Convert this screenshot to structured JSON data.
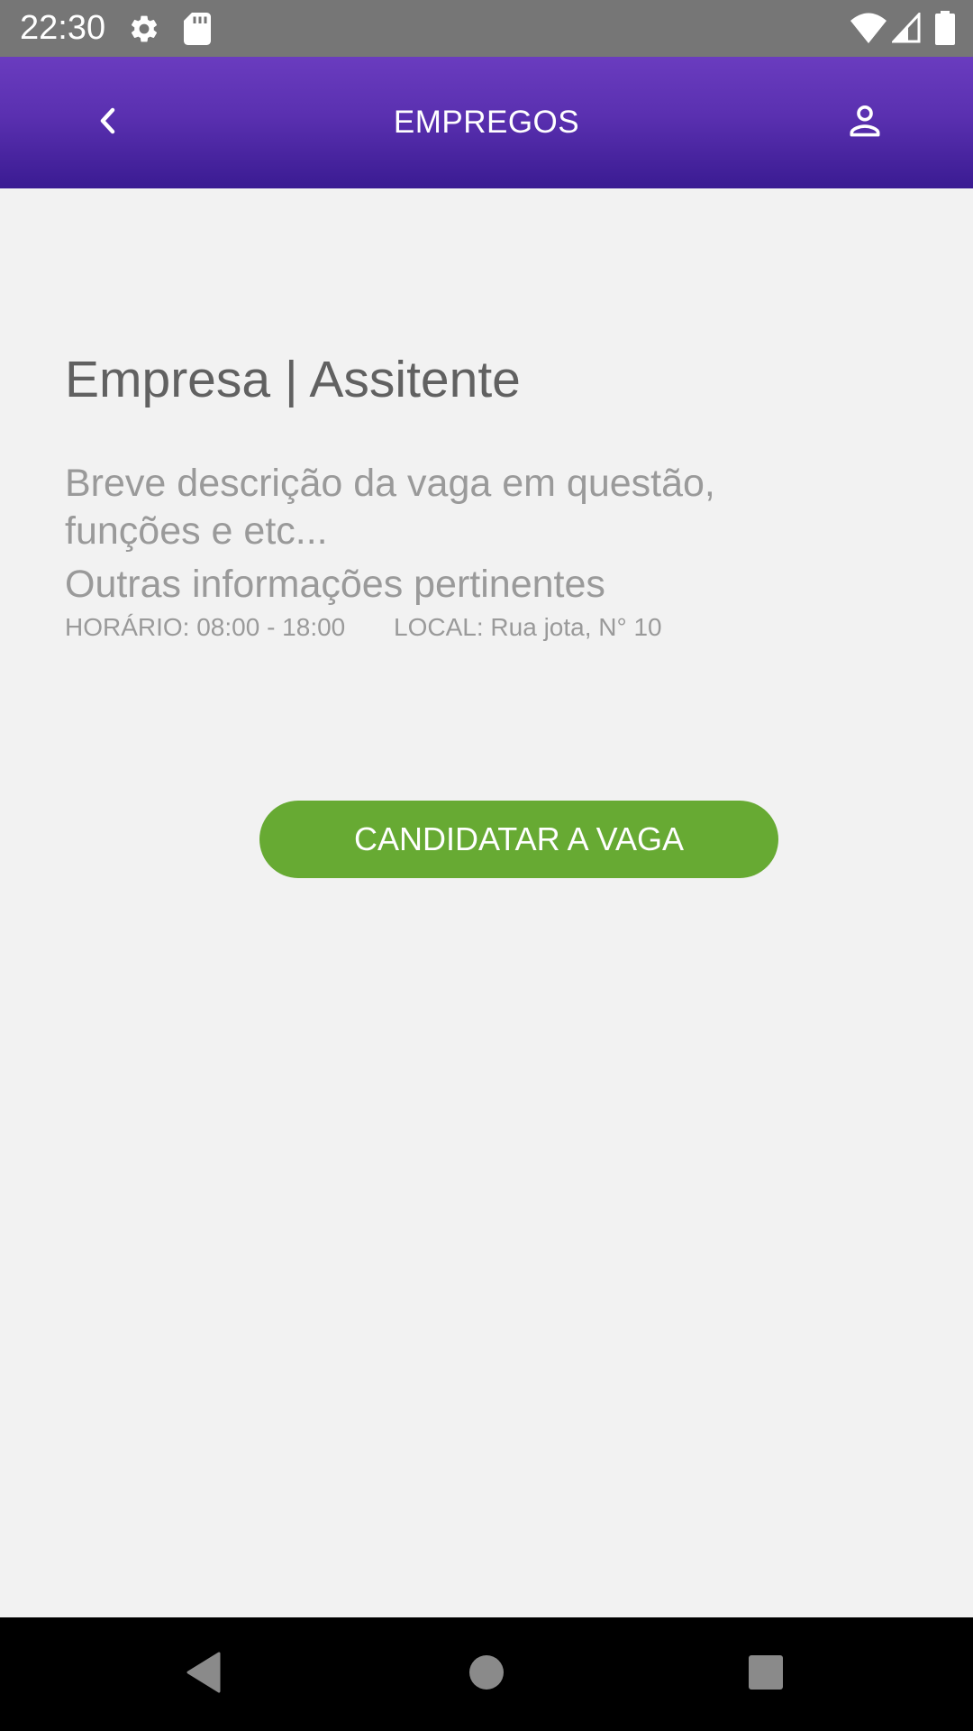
{
  "status_bar": {
    "time": "22:30",
    "icons": [
      "gear-icon",
      "sd-card-icon",
      "wifi-icon",
      "signal-icon",
      "battery-icon"
    ]
  },
  "app_bar": {
    "title": "EMPREGOS",
    "back_icon": "chevron-left-icon",
    "profile_icon": "person-icon"
  },
  "job": {
    "title": "Empresa | Assitente",
    "description": "Breve descrição da vaga em questão, funções e etc...",
    "other_info": "Outras informações pertinentes",
    "schedule": "HORÁRIO: 08:00 - 18:00",
    "location": "LOCAL: Rua jota, N° 10"
  },
  "actions": {
    "apply_label": "CANDIDATAR A VAGA"
  },
  "nav_bar": {
    "buttons": [
      "back-triangle-icon",
      "home-circle-icon",
      "recents-square-icon"
    ]
  },
  "colors": {
    "app_bar_top": "#6a3cbf",
    "app_bar_bottom": "#3a1b92",
    "apply_button": "#67aa33",
    "background": "#f2f2f2",
    "status_bar": "#767676"
  }
}
